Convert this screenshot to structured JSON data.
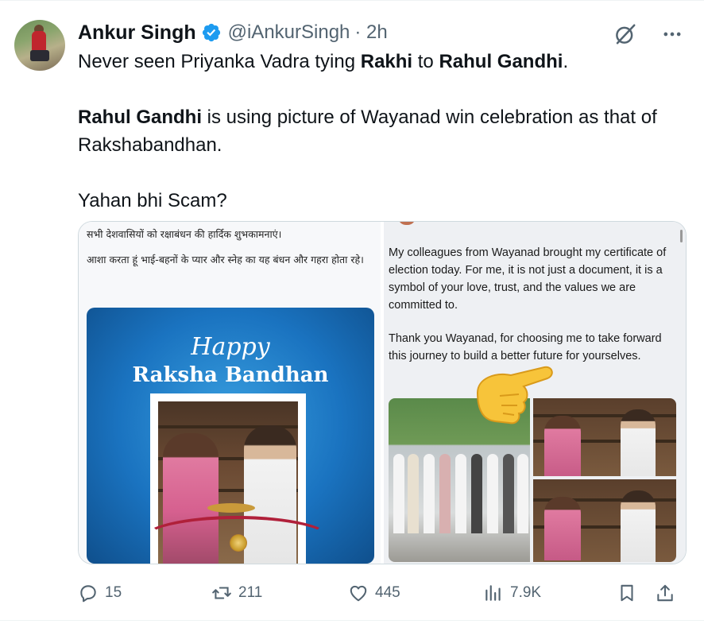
{
  "author": {
    "name": "Ankur Singh",
    "handle": "@iAnkurSingh",
    "time": "· 2h",
    "verified_color": "#1d9bf0"
  },
  "tweet": {
    "l1_a": "Never seen Priyanka Vadra tying ",
    "l1_b": "Rakhi",
    "l1_c": " to ",
    "l1_d": "Rahul Gandhi",
    "l1_e": ".",
    "l2_a": "Rahul Gandhi",
    "l2_b": " is using picture of Wayanad win celebration as that of Rakshabandhan.",
    "l3": "Yahan bhi Scam?"
  },
  "media": {
    "hindi_1": "सभी देशवासियों को रक्षाबंधन की हार्दिक शुभकामनाएं।",
    "hindi_2": "आशा करता हूं भाई-बहनों के प्यार और स्नेह का यह बंधन और गहरा होता रहे।",
    "card_happy": "Happy",
    "card_rb": "Raksha Bandhan",
    "post_1": "My colleagues from Wayanad brought my certificate of election today. For me, it is not just a document, it is a symbol of your love, trust, and the values we are committed to.",
    "post_2": "Thank you Wayanad, for choosing me to take forward this journey to build a better future for yourselves."
  },
  "actions": {
    "replies": "15",
    "reposts": "211",
    "likes": "445",
    "views": "7.9K"
  },
  "icons": {
    "grok": "grok-icon",
    "more": "more-icon",
    "reply": "reply-icon",
    "repost": "repost-icon",
    "like": "like-icon",
    "views": "views-icon",
    "bookmark": "bookmark-icon",
    "share": "share-icon",
    "pointer": "pointing-hand-emoji"
  },
  "colors": {
    "text": "#0f1419",
    "muted": "#536471",
    "brand": "#1d9bf0"
  }
}
